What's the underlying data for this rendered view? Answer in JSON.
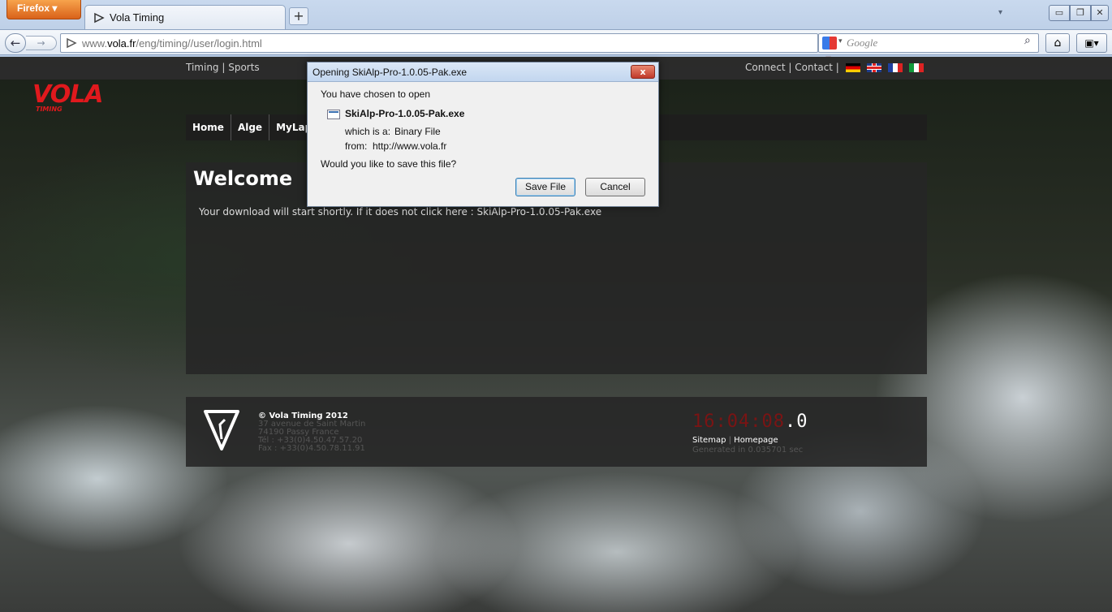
{
  "browser": {
    "app_button": "Firefox",
    "tab_title": "Vola Timing",
    "new_tab": "+",
    "url_prefix": "www.",
    "url_host": "vola.fr",
    "url_path": "/eng/timing//user/login.html",
    "search_placeholder": "Google"
  },
  "site": {
    "top_left_links": "Timing | Sports",
    "top_right_links": "Connect | Contact |",
    "logo_word": "VOLA",
    "logo_sub": "TIMING",
    "nav": [
      "Home",
      "Alge",
      "MyLap"
    ],
    "heading": "Welcome",
    "download_message": "Your download will start shortly. If it does not click here : SkiAlp-Pro-1.0.05-Pak.exe",
    "footer": {
      "copyright": "© Vola Timing 2012",
      "address": [
        "37 avenue de Saint Martin",
        "74190 Passy France",
        "Tél : +33(0)4.50.47.57.20",
        "Fax : +33(0)4.50.78.11.91"
      ],
      "clock_main": "16:04:08",
      "clock_tenth": ".0",
      "link_sitemap": "Sitemap",
      "link_separator": "|",
      "link_homepage": "Homepage",
      "generated": "Generated in 0.035701 sec"
    }
  },
  "dialog": {
    "title": "Opening SkiAlp-Pro-1.0.05-Pak.exe",
    "close_label": "x",
    "intro": "You have chosen to open",
    "filename": "SkiAlp-Pro-1.0.05-Pak.exe",
    "type_label": "which is a:",
    "type_value": "Binary File",
    "from_label": "from:",
    "from_value": "http://www.vola.fr",
    "question": "Would you like to save this file?",
    "save_button": "Save File",
    "cancel_button": "Cancel"
  },
  "colors": {
    "brand_red": "#e0191d",
    "firefox_orange": "#e87722"
  }
}
